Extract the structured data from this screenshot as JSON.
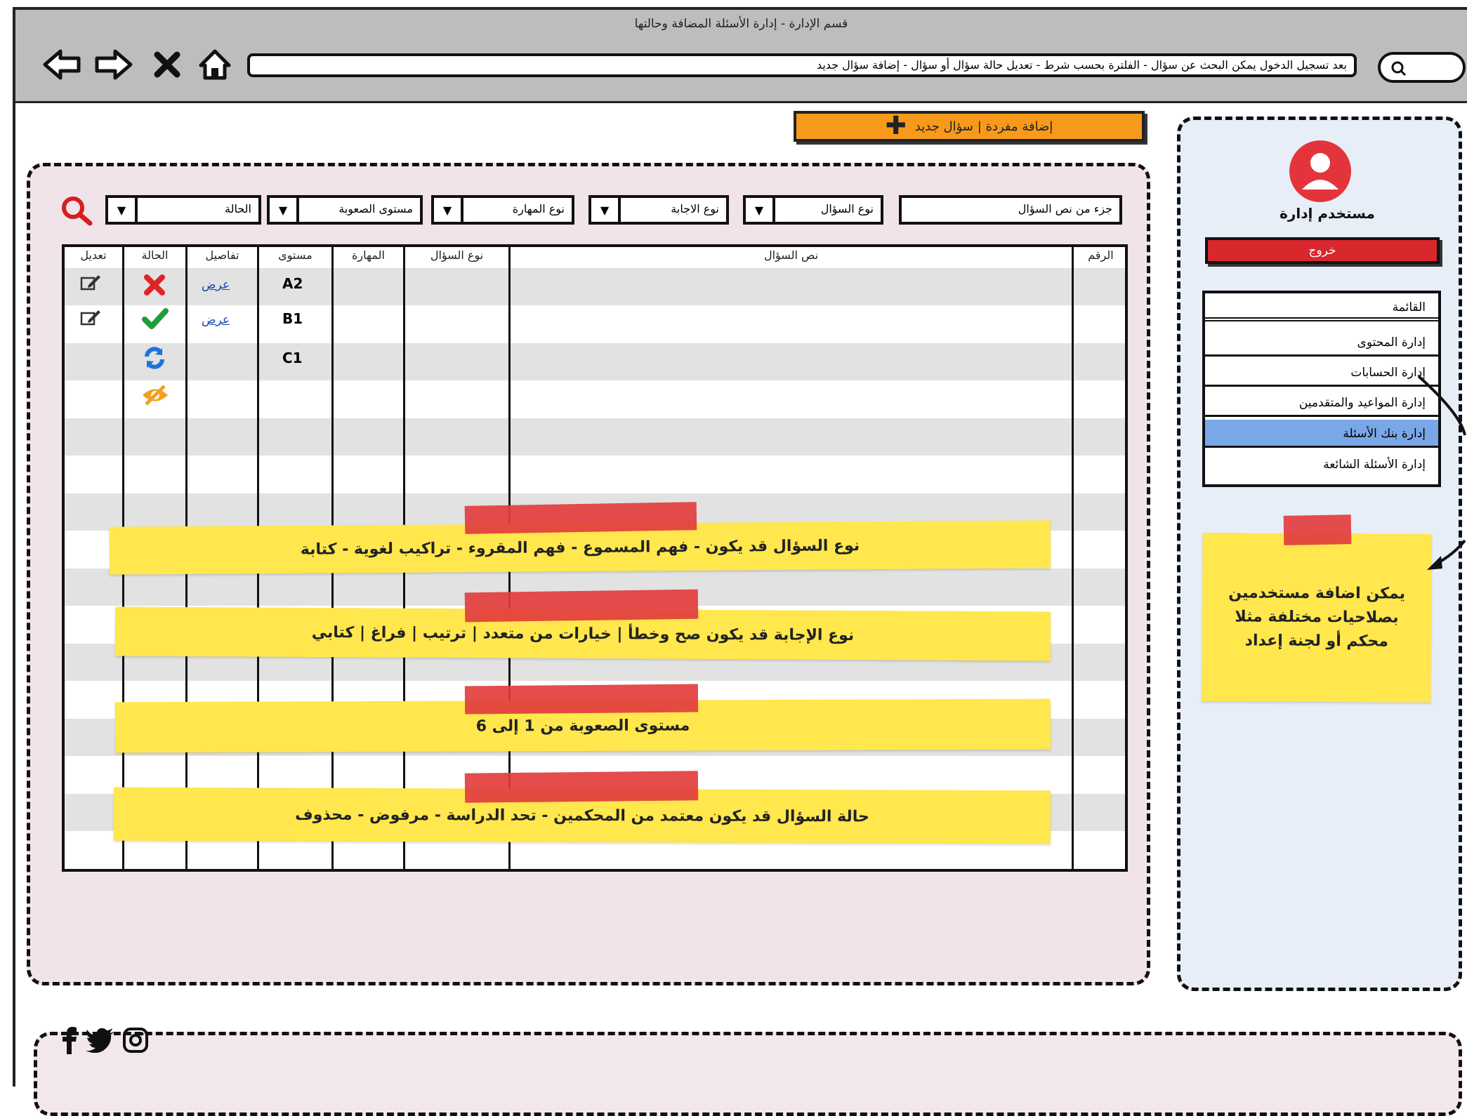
{
  "window_title": "قسم الإدارة - إدارة الأسئلة المضافة وحالتها",
  "nav": {
    "back_icon": "arrow-left-icon",
    "forward_icon": "arrow-right-icon",
    "close_icon": "close-icon",
    "home_icon": "home-icon"
  },
  "address_text": "بعد تسجيل الدخول يمكن البحث عن سؤال - الفلترة بحسب شرط - تعديل حالة سؤال أو سؤال - إضافة سؤال جديد",
  "add_button": {
    "label": "إضافة مفردة | سؤال جديد",
    "icon": "plus-icon"
  },
  "filters": {
    "search_text_placeholder": "جزء من نص السؤال",
    "question_type": "نوع السؤال",
    "answer_type": "نوع الاجابة",
    "skill_type": "نوع المهارة",
    "difficulty": "مستوى الصعوبة",
    "status": "الحالة"
  },
  "table": {
    "headers": {
      "number": "الرقم",
      "text": "نص السؤال",
      "question_type": "نوع السؤال",
      "skill": "المهارة",
      "level": "مستوى",
      "details": "تفاصيل",
      "status": "الحالة",
      "edit": "تعديل"
    },
    "rows": [
      {
        "level": "A2",
        "details": "عرض",
        "status_icon": "rejected-x-icon",
        "edit_icon": "edit-icon"
      },
      {
        "level": "B1",
        "details": "عرض",
        "status_icon": "approved-check-icon",
        "edit_icon": "edit-icon"
      },
      {
        "level": "C1",
        "details": "",
        "status_icon": "refresh-icon",
        "edit_icon": ""
      },
      {
        "level": "",
        "details": "",
        "status_icon": "hidden-eye-icon",
        "edit_icon": ""
      }
    ]
  },
  "notes": [
    "نوع السؤال قد يكون - فهم المسموع - فهم المقروء - تراكيب لغوية - كتابة",
    "نوع الإجابة قد يكون صح وخطأ | خيارات من متعدد | ترتيب | فراغ | كتابي",
    "مستوى الصعوبة من 1 إلى 6",
    "حالة السؤال قد يكون معتمد من المحكمين - تحد الدراسة - مرفوض - محذوف"
  ],
  "sidebar": {
    "username": "مستخدم إدارة",
    "logout": "خروج",
    "menu": [
      {
        "label": "القائمة",
        "selected": false
      },
      {
        "label": "إدارة المحتوى",
        "selected": false
      },
      {
        "label": "إدارة الحسابات",
        "selected": false
      },
      {
        "label": "إدارة المواعيد والمتقدمين",
        "selected": false
      },
      {
        "label": "إدارة بنك الأسئلة",
        "selected": true
      },
      {
        "label": "إدارة الأسئلة الشائعة",
        "selected": false
      }
    ],
    "sticky_note": "يمكن اضافة مستخدمين بصلاحيات مختلفة مثلا محكم أو لجنة إعداد"
  },
  "footer": {
    "social_icons": [
      "facebook-icon",
      "twitter-icon",
      "instagram-icon"
    ]
  },
  "colors": {
    "add_button": "#f79a1b",
    "logout": "#d9272e",
    "selected_menu": "#7aa7e8",
    "note": "#ffe74d",
    "tape": "#e33d3d",
    "main_panel": "#f1e3ea",
    "sidebar_panel": "#e8eef8"
  }
}
